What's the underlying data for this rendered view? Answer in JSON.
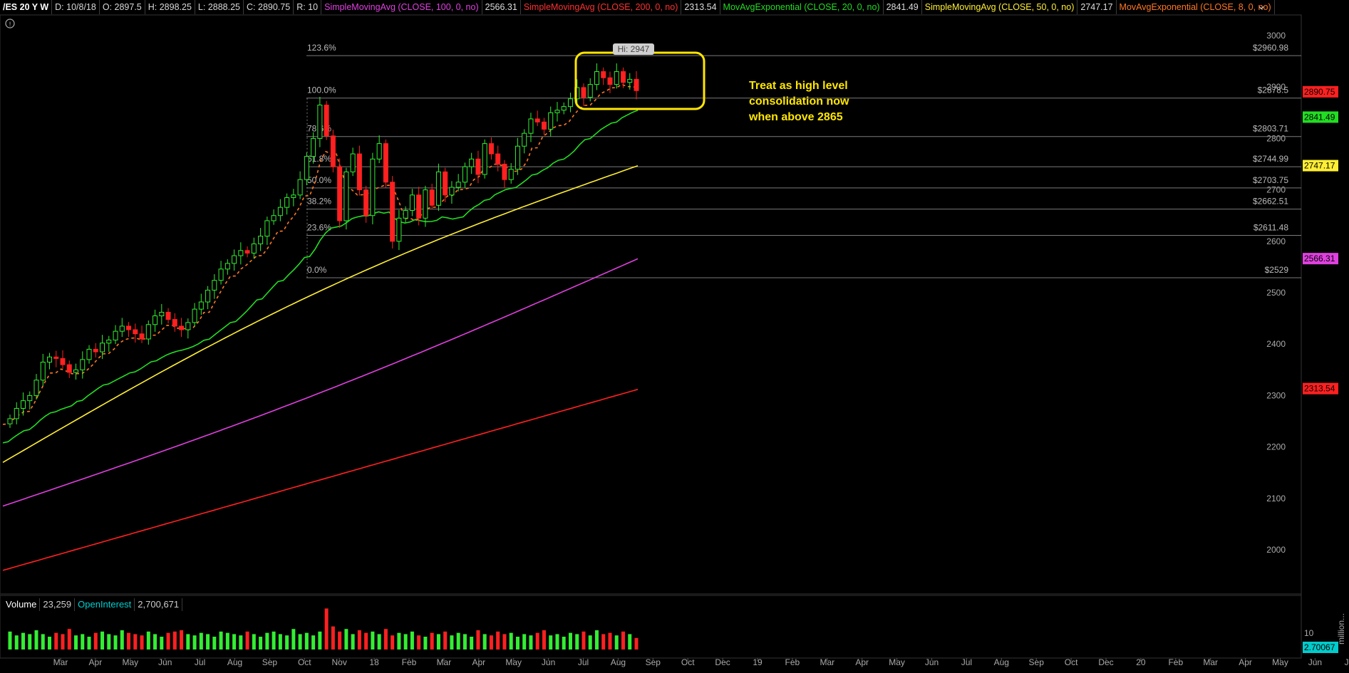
{
  "header": {
    "symbol": "/ES 20 Y W",
    "date": "D: 10/8/18",
    "open": "O: 2897.5",
    "high": "H: 2898.25",
    "low": "L: 2888.25",
    "close": "C: 2890.75",
    "range": "R: 10",
    "studies": [
      {
        "label": "SimpleMovingAvg (CLOSE, 100, 0, no)",
        "value": "2566.31",
        "color": "#e040e0"
      },
      {
        "label": "SimpleMovingAvg (CLOSE, 200, 0, no)",
        "value": "2313.54",
        "color": "#ff3030"
      },
      {
        "label": "MovAvgExponential (CLOSE, 20, 0, no)",
        "value": "2841.49",
        "color": "#22dd22"
      },
      {
        "label": "SimpleMovingAvg (CLOSE, 50, 0, no)",
        "value": "2747.17",
        "color": "#ffee33"
      },
      {
        "label": "MovAvgExponential (CLOSE, 8, 0, no)",
        "value": "",
        "color": "#ff7722"
      }
    ]
  },
  "volume_panel": {
    "volume_label": "Volume",
    "volume_value": "23,259",
    "oi_label": "OpenInterest",
    "oi_value": "2,700,671",
    "axis_label": "10",
    "unit_label": "million...",
    "badge_value": "2.70067"
  },
  "chart_data": {
    "type": "candlestick",
    "y_range": [
      1920,
      3020
    ],
    "yticks": [
      "3000",
      "2900",
      "2800",
      "2700",
      "2600",
      "2500",
      "2400",
      "2300",
      "2200",
      "2100",
      "2000"
    ],
    "xticks": [
      "Mar",
      "Apr",
      "May",
      "Jun",
      "Jul",
      "Aug",
      "Sep",
      "Oct",
      "Nov",
      "18",
      "Feb",
      "Mar",
      "Apr",
      "May",
      "Jun",
      "Jul",
      "Aug",
      "Sep",
      "Oct",
      "Dec",
      "19",
      "Feb",
      "Mar",
      "Apr",
      "May",
      "Jun",
      "Jul",
      "Aug",
      "Sep",
      "Oct",
      "Dec",
      "20",
      "Feb",
      "Mar",
      "Apr",
      "May",
      "Jun",
      "Jul"
    ],
    "fib_levels": [
      {
        "pct": "123.6%",
        "price": 2960.98,
        "label": "$2960.98"
      },
      {
        "pct": "100.0%",
        "price": 2878.5,
        "label": "$2878.5"
      },
      {
        "pct": "78.6%",
        "price": 2803.71,
        "label": "$2803.71"
      },
      {
        "pct": "61.8%",
        "price": 2744.99,
        "label": "$2744.99"
      },
      {
        "pct": "50.0%",
        "price": 2703.75,
        "label": "$2703.75"
      },
      {
        "pct": "38.2%",
        "price": 2662.51,
        "label": "$2662.51"
      },
      {
        "pct": "23.6%",
        "price": 2611.48,
        "label": "$2611.48"
      },
      {
        "pct": "0.0%",
        "price": 2529,
        "label": "$2529"
      }
    ],
    "price_badges": [
      {
        "value": "2890.75",
        "price": 2890.75,
        "color": "#ff2020",
        "text_color": "#000"
      },
      {
        "value": "2841.49",
        "price": 2841.49,
        "color": "#22dd22",
        "text_color": "#000"
      },
      {
        "value": "2747.17",
        "price": 2747.17,
        "color": "#ffee33",
        "text_color": "#000"
      },
      {
        "value": "2566.31",
        "price": 2566.31,
        "color": "#e040e0",
        "text_color": "#000"
      },
      {
        "value": "2313.54",
        "price": 2313.54,
        "color": "#ff2020",
        "text_color": "#000"
      }
    ],
    "annotation": {
      "lines": [
        "Treat as high level",
        "consolidation now",
        "when above 2865"
      ],
      "color": "#ffe600"
    },
    "hi_label": "Hi: 2947",
    "series": [
      {
        "name": "SMA 200",
        "color": "#ff2020",
        "start": 1960,
        "end": 2312
      },
      {
        "name": "SMA 100",
        "color": "#e040e0",
        "start": 2085,
        "end": 2566
      },
      {
        "name": "SMA 50",
        "color": "#ffee33",
        "start": 2170,
        "end": 2747
      },
      {
        "name": "EMA 20",
        "color": "#22dd22",
        "start": 2200,
        "end": 2841
      },
      {
        "name": "EMA 8",
        "color": "#ff7722",
        "start": 2245,
        "end": 2880
      }
    ],
    "closes": [
      2255,
      2275,
      2290,
      2300,
      2330,
      2365,
      2375,
      2372,
      2360,
      2345,
      2350,
      2370,
      2390,
      2385,
      2402,
      2408,
      2425,
      2435,
      2428,
      2420,
      2410,
      2438,
      2455,
      2462,
      2448,
      2435,
      2428,
      2442,
      2468,
      2482,
      2505,
      2524,
      2546,
      2557,
      2572,
      2582,
      2577,
      2595,
      2610,
      2640,
      2650,
      2666,
      2685,
      2690,
      2720,
      2765,
      2800,
      2865,
      2805,
      2745,
      2640,
      2735,
      2770,
      2700,
      2650,
      2760,
      2790,
      2715,
      2600,
      2645,
      2660,
      2690,
      2645,
      2700,
      2670,
      2735,
      2690,
      2705,
      2715,
      2745,
      2760,
      2730,
      2790,
      2770,
      2750,
      2720,
      2740,
      2785,
      2810,
      2838,
      2832,
      2818,
      2850,
      2855,
      2862,
      2877,
      2899,
      2880,
      2905,
      2930,
      2918,
      2905,
      2930,
      2909,
      2915,
      2893
    ],
    "volumes": [
      1.4,
      1.1,
      1.3,
      1.2,
      1.5,
      1.2,
      1.0,
      1.3,
      1.2,
      1.6,
      1.1,
      1.2,
      1.0,
      1.3,
      1.4,
      1.2,
      1.1,
      1.5,
      1.3,
      1.2,
      1.1,
      1.4,
      1.2,
      1.0,
      1.3,
      1.4,
      1.5,
      1.2,
      1.1,
      1.3,
      1.2,
      1.0,
      1.4,
      1.3,
      1.2,
      1.1,
      1.4,
      1.2,
      1.0,
      1.3,
      1.4,
      1.2,
      1.1,
      1.6,
      1.2,
      1.3,
      1.1,
      1.4,
      3.2,
      1.8,
      1.4,
      1.6,
      1.2,
      1.5,
      1.3,
      1.4,
      1.2,
      1.6,
      1.1,
      1.3,
      1.2,
      1.4,
      1.1,
      1.0,
      1.3,
      1.2,
      1.4,
      1.1,
      1.3,
      1.2,
      1.0,
      1.5,
      1.2,
      1.1,
      1.4,
      1.2,
      1.3,
      1.0,
      1.2,
      1.1,
      1.3,
      1.5,
      1.1,
      1.2,
      1.0,
      1.3,
      1.2,
      1.4,
      1.1,
      1.5,
      1.2,
      1.3,
      1.1,
      1.4,
      1.2,
      0.9
    ]
  }
}
